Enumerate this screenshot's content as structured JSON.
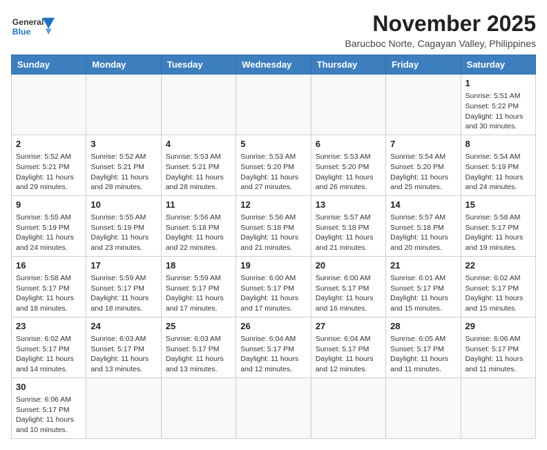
{
  "header": {
    "logo_general": "General",
    "logo_blue": "Blue",
    "title": "November 2025",
    "subtitle": "Barucboc Norte, Cagayan Valley, Philippines"
  },
  "weekdays": [
    "Sunday",
    "Monday",
    "Tuesday",
    "Wednesday",
    "Thursday",
    "Friday",
    "Saturday"
  ],
  "weeks": [
    [
      null,
      null,
      null,
      null,
      null,
      null,
      {
        "day": "1",
        "sunrise": "Sunrise: 5:51 AM",
        "sunset": "Sunset: 5:22 PM",
        "daylight": "Daylight: 11 hours and 30 minutes."
      }
    ],
    [
      {
        "day": "2",
        "sunrise": "Sunrise: 5:52 AM",
        "sunset": "Sunset: 5:21 PM",
        "daylight": "Daylight: 11 hours and 29 minutes."
      },
      {
        "day": "3",
        "sunrise": "Sunrise: 5:52 AM",
        "sunset": "Sunset: 5:21 PM",
        "daylight": "Daylight: 11 hours and 28 minutes."
      },
      {
        "day": "4",
        "sunrise": "Sunrise: 5:53 AM",
        "sunset": "Sunset: 5:21 PM",
        "daylight": "Daylight: 11 hours and 28 minutes."
      },
      {
        "day": "5",
        "sunrise": "Sunrise: 5:53 AM",
        "sunset": "Sunset: 5:20 PM",
        "daylight": "Daylight: 11 hours and 27 minutes."
      },
      {
        "day": "6",
        "sunrise": "Sunrise: 5:53 AM",
        "sunset": "Sunset: 5:20 PM",
        "daylight": "Daylight: 11 hours and 26 minutes."
      },
      {
        "day": "7",
        "sunrise": "Sunrise: 5:54 AM",
        "sunset": "Sunset: 5:20 PM",
        "daylight": "Daylight: 11 hours and 25 minutes."
      },
      {
        "day": "8",
        "sunrise": "Sunrise: 5:54 AM",
        "sunset": "Sunset: 5:19 PM",
        "daylight": "Daylight: 11 hours and 24 minutes."
      }
    ],
    [
      {
        "day": "9",
        "sunrise": "Sunrise: 5:55 AM",
        "sunset": "Sunset: 5:19 PM",
        "daylight": "Daylight: 11 hours and 24 minutes."
      },
      {
        "day": "10",
        "sunrise": "Sunrise: 5:55 AM",
        "sunset": "Sunset: 5:19 PM",
        "daylight": "Daylight: 11 hours and 23 minutes."
      },
      {
        "day": "11",
        "sunrise": "Sunrise: 5:56 AM",
        "sunset": "Sunset: 5:18 PM",
        "daylight": "Daylight: 11 hours and 22 minutes."
      },
      {
        "day": "12",
        "sunrise": "Sunrise: 5:56 AM",
        "sunset": "Sunset: 5:18 PM",
        "daylight": "Daylight: 11 hours and 21 minutes."
      },
      {
        "day": "13",
        "sunrise": "Sunrise: 5:57 AM",
        "sunset": "Sunset: 5:18 PM",
        "daylight": "Daylight: 11 hours and 21 minutes."
      },
      {
        "day": "14",
        "sunrise": "Sunrise: 5:57 AM",
        "sunset": "Sunset: 5:18 PM",
        "daylight": "Daylight: 11 hours and 20 minutes."
      },
      {
        "day": "15",
        "sunrise": "Sunrise: 5:58 AM",
        "sunset": "Sunset: 5:17 PM",
        "daylight": "Daylight: 11 hours and 19 minutes."
      }
    ],
    [
      {
        "day": "16",
        "sunrise": "Sunrise: 5:58 AM",
        "sunset": "Sunset: 5:17 PM",
        "daylight": "Daylight: 11 hours and 18 minutes."
      },
      {
        "day": "17",
        "sunrise": "Sunrise: 5:59 AM",
        "sunset": "Sunset: 5:17 PM",
        "daylight": "Daylight: 11 hours and 18 minutes."
      },
      {
        "day": "18",
        "sunrise": "Sunrise: 5:59 AM",
        "sunset": "Sunset: 5:17 PM",
        "daylight": "Daylight: 11 hours and 17 minutes."
      },
      {
        "day": "19",
        "sunrise": "Sunrise: 6:00 AM",
        "sunset": "Sunset: 5:17 PM",
        "daylight": "Daylight: 11 hours and 17 minutes."
      },
      {
        "day": "20",
        "sunrise": "Sunrise: 6:00 AM",
        "sunset": "Sunset: 5:17 PM",
        "daylight": "Daylight: 11 hours and 16 minutes."
      },
      {
        "day": "21",
        "sunrise": "Sunrise: 6:01 AM",
        "sunset": "Sunset: 5:17 PM",
        "daylight": "Daylight: 11 hours and 15 minutes."
      },
      {
        "day": "22",
        "sunrise": "Sunrise: 6:02 AM",
        "sunset": "Sunset: 5:17 PM",
        "daylight": "Daylight: 11 hours and 15 minutes."
      }
    ],
    [
      {
        "day": "23",
        "sunrise": "Sunrise: 6:02 AM",
        "sunset": "Sunset: 5:17 PM",
        "daylight": "Daylight: 11 hours and 14 minutes."
      },
      {
        "day": "24",
        "sunrise": "Sunrise: 6:03 AM",
        "sunset": "Sunset: 5:17 PM",
        "daylight": "Daylight: 11 hours and 13 minutes."
      },
      {
        "day": "25",
        "sunrise": "Sunrise: 6:03 AM",
        "sunset": "Sunset: 5:17 PM",
        "daylight": "Daylight: 11 hours and 13 minutes."
      },
      {
        "day": "26",
        "sunrise": "Sunrise: 6:04 AM",
        "sunset": "Sunset: 5:17 PM",
        "daylight": "Daylight: 11 hours and 12 minutes."
      },
      {
        "day": "27",
        "sunrise": "Sunrise: 6:04 AM",
        "sunset": "Sunset: 5:17 PM",
        "daylight": "Daylight: 11 hours and 12 minutes."
      },
      {
        "day": "28",
        "sunrise": "Sunrise: 6:05 AM",
        "sunset": "Sunset: 5:17 PM",
        "daylight": "Daylight: 11 hours and 11 minutes."
      },
      {
        "day": "29",
        "sunrise": "Sunrise: 6:06 AM",
        "sunset": "Sunset: 5:17 PM",
        "daylight": "Daylight: 11 hours and 11 minutes."
      }
    ],
    [
      {
        "day": "30",
        "sunrise": "Sunrise: 6:06 AM",
        "sunset": "Sunset: 5:17 PM",
        "daylight": "Daylight: 11 hours and 10 minutes."
      },
      null,
      null,
      null,
      null,
      null,
      null
    ]
  ]
}
